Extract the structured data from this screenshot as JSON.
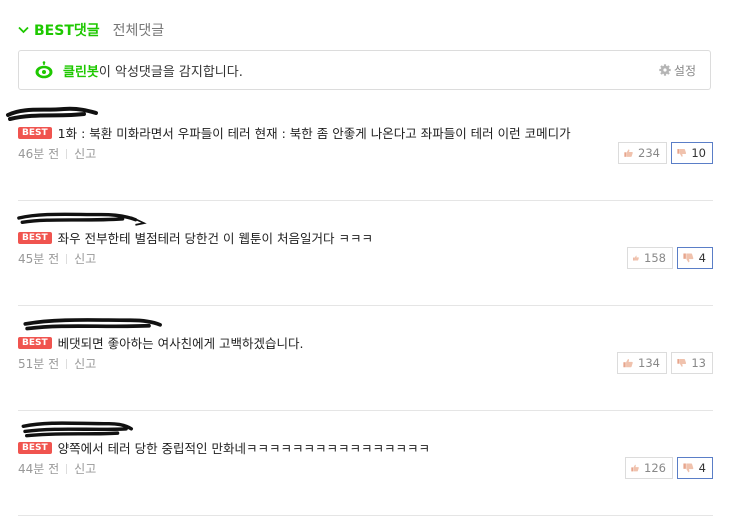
{
  "tabs": {
    "best": "BEST댓글",
    "all": "전체댓글"
  },
  "cleanbot": {
    "name": "클린봇",
    "message": "이 악성댓글을 감지합니다.",
    "settings": "설정"
  },
  "comments": [
    {
      "badge": "BEST",
      "text": "1화 : 북환 미화라면서 우파들이 테러 현재 : 북한 좀 안좋게 나온다고 좌파들이 테러 이런 코메디가",
      "time": "46분 전",
      "report": "신고",
      "likes": "234",
      "dislikes": "10",
      "dislike_active": true
    },
    {
      "badge": "BEST",
      "text": "좌우 전부한테 별점테러 당한건 이 웹툰이 처음일거다 ㅋㅋㅋ",
      "time": "45분 전",
      "report": "신고",
      "likes": "158",
      "dislikes": "4",
      "dislike_active": true
    },
    {
      "badge": "BEST",
      "text": "베댓되면 좋아하는 여사친에게 고백하겠습니다.",
      "time": "51분 전",
      "report": "신고",
      "likes": "134",
      "dislikes": "13",
      "dislike_active": false
    },
    {
      "badge": "BEST",
      "text": "양쪽에서 테러 당한 중립적인 만화네ㅋㅋㅋㅋㅋㅋㅋㅋㅋㅋㅋㅋㅋㅋㅋㅋ",
      "time": "44분 전",
      "report": "신고",
      "likes": "126",
      "dislikes": "4",
      "dislike_active": true
    }
  ]
}
